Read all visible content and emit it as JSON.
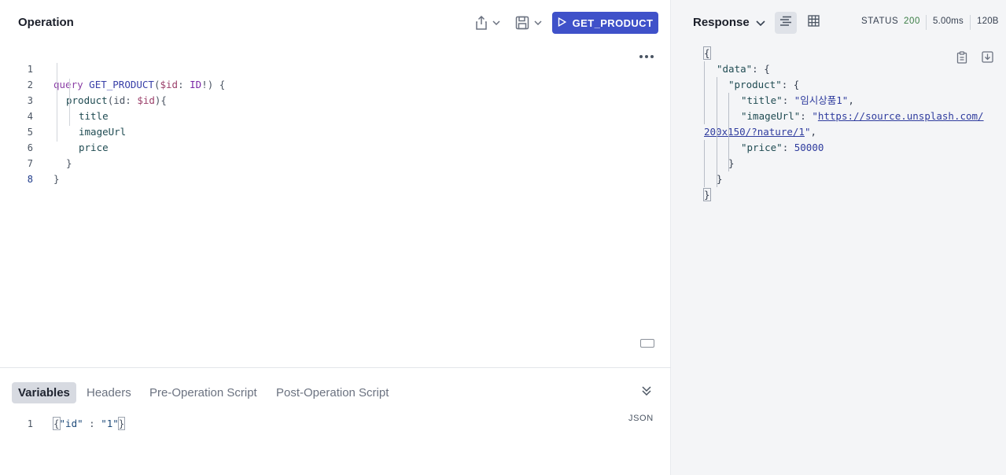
{
  "operation": {
    "title": "Operation",
    "run_button_label": "GET_PRODUCT",
    "query_lines": [
      {
        "n": "1",
        "keyword": "query",
        "name": "GET_PRODUCT",
        "open": "(",
        "var": "$id",
        "colon": ": ",
        "type": "ID",
        "bang": "!",
        "close": ") {"
      },
      {
        "n": "2",
        "text_field": "product",
        "args_open": "(id: ",
        "arg_var": "$id",
        "args_close": "){"
      },
      {
        "n": "3",
        "field": "title"
      },
      {
        "n": "4",
        "field": "imageUrl"
      },
      {
        "n": "5",
        "field": "price"
      },
      {
        "n": "6",
        "brace": "}"
      },
      {
        "n": "7",
        "brace": "}"
      },
      {
        "n": "8",
        "brace": ""
      }
    ]
  },
  "bottom_panel": {
    "tabs": [
      "Variables",
      "Headers",
      "Pre-Operation Script",
      "Post-Operation Script"
    ],
    "active_tab": "Variables",
    "format_label": "JSON",
    "variables_line_number": "1",
    "variables_text": {
      "open": "{",
      "key": "\"id\"",
      "mid": " : ",
      "value": "\"1\"",
      "close": "}"
    }
  },
  "response": {
    "title": "Response",
    "status_label": "STATUS",
    "status_code": "200",
    "time": "5.00ms",
    "size": "120B",
    "status_color": "#3a7d44",
    "lines": {
      "l1": "{",
      "data_key": "\"data\"",
      "product_key": "\"product\"",
      "title_key": "\"title\"",
      "title_value": "\"임시상품1\"",
      "imageUrl_key": "\"imageUrl\"",
      "imageUrl_value_part1": "https://source.unsplash.com/",
      "imageUrl_value_part2": "200x150/?nature/1",
      "price_key": "\"price\"",
      "price_value": "50000"
    }
  },
  "colors": {
    "run_button": "#3f51c9",
    "accent": "#3940a8"
  }
}
